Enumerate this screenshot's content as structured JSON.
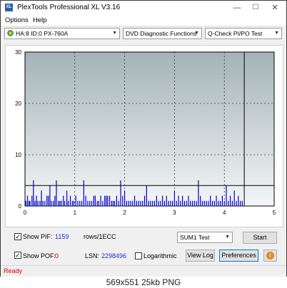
{
  "window": {
    "icon_text": "XL",
    "title": "PlexTools Professional XL V3.16",
    "minimize_glyph": "—",
    "maximize_glyph": "☐",
    "close_glyph": "✕"
  },
  "menu": {
    "options": "Options",
    "help": "Help"
  },
  "toolbar": {
    "drive": "HA:8 ID:0  PX-760A",
    "function": "DVD Diagnostic Functions",
    "test": "Q-Check PI/PO Test",
    "arrow_glyph": "▼"
  },
  "chart_data": {
    "type": "bar",
    "ylim": [
      0,
      30
    ],
    "xlim": [
      0,
      5
    ],
    "yticks": [
      "0",
      "10",
      "20",
      "30"
    ],
    "xticks": [
      "0",
      "1",
      "2",
      "3",
      "4",
      "5"
    ],
    "grid": true,
    "threshold": 4,
    "end_marker_x": 4.4,
    "background_gradient": [
      "#a3b3b8",
      "#f4f6f6"
    ],
    "bar_color": "#0000cc",
    "series": [
      {
        "x": [
          0.02,
          0.05,
          0.08,
          0.1,
          0.14,
          0.17,
          0.2,
          0.23,
          0.26,
          0.3,
          0.33,
          0.36,
          0.4,
          0.44,
          0.47,
          0.5,
          0.53,
          0.57,
          0.6,
          0.63,
          0.67,
          0.7,
          0.73,
          0.77,
          0.8,
          0.84,
          0.87,
          0.91,
          0.95,
          0.98,
          1.02,
          1.06,
          1.1,
          1.14,
          1.18,
          1.22,
          1.26,
          1.3,
          1.34,
          1.38,
          1.41,
          1.45,
          1.48,
          1.52,
          1.56,
          1.6,
          1.63,
          1.66,
          1.7,
          1.74,
          1.77,
          1.8,
          1.84,
          1.88,
          1.92,
          1.96,
          2.0,
          2.04,
          2.08,
          2.12,
          2.16,
          2.2,
          2.24,
          2.28,
          2.32,
          2.36,
          2.4,
          2.44,
          2.48,
          2.52,
          2.56,
          2.6,
          2.64,
          2.68,
          2.72,
          2.76,
          2.8,
          2.84,
          2.88,
          2.92,
          2.96,
          3.0,
          3.04,
          3.08,
          3.12,
          3.16,
          3.2,
          3.24,
          3.28,
          3.32,
          3.36,
          3.4,
          3.44,
          3.48,
          3.52,
          3.56,
          3.6,
          3.64,
          3.68,
          3.72,
          3.76,
          3.8,
          3.84,
          3.88,
          3.92,
          3.96,
          4.0,
          4.04,
          4.08,
          4.12,
          4.16,
          4.2,
          4.24,
          4.28,
          4.32,
          4.36
        ],
        "values": [
          1,
          2,
          1,
          1,
          2,
          5,
          1,
          2,
          1,
          1,
          3,
          1,
          1,
          2,
          2,
          4,
          1,
          1,
          2,
          5,
          1,
          1,
          1,
          2,
          1,
          3,
          1,
          2,
          1,
          1,
          2,
          1,
          1,
          1,
          5,
          2,
          1,
          1,
          1,
          2,
          2,
          1,
          1,
          2,
          1,
          2,
          2,
          2,
          2,
          1,
          1,
          1,
          2,
          1,
          5,
          2,
          3,
          1,
          1,
          1,
          1,
          2,
          1,
          1,
          1,
          1,
          2,
          4,
          1,
          1,
          1,
          1,
          2,
          1,
          1,
          2,
          1,
          2,
          1,
          1,
          1,
          3,
          1,
          2,
          1,
          2,
          1,
          1,
          2,
          1,
          1,
          1,
          1,
          5,
          2,
          1,
          1,
          1,
          1,
          2,
          1,
          1,
          2,
          1,
          1,
          2,
          1,
          4,
          1,
          2,
          1,
          3,
          1,
          2,
          1,
          1
        ]
      }
    ]
  },
  "controls": {
    "show_pif_label": "Show PIF:",
    "pif_value": "1159",
    "rows_label": "rows/1ECC",
    "show_pof_label": "Show POF:",
    "pof_value": "0",
    "lsn_label": "LSN:",
    "lsn_value": "2298496",
    "logarithmic_label": "Logarithmic",
    "sum_select": "SUM1 Test",
    "start_button": "Start",
    "view_log_button": "View Log",
    "preferences_button": "Preferences",
    "info_glyph": "i",
    "check_glyph": "✓"
  },
  "status": {
    "text": "Ready"
  },
  "caption": {
    "text": "569x551  25kb  PNG"
  },
  "colors": {
    "accent": "#0078d7",
    "value_blue": "#1e2fd0",
    "value_red": "#d00000",
    "status_red": "#dd0000"
  }
}
